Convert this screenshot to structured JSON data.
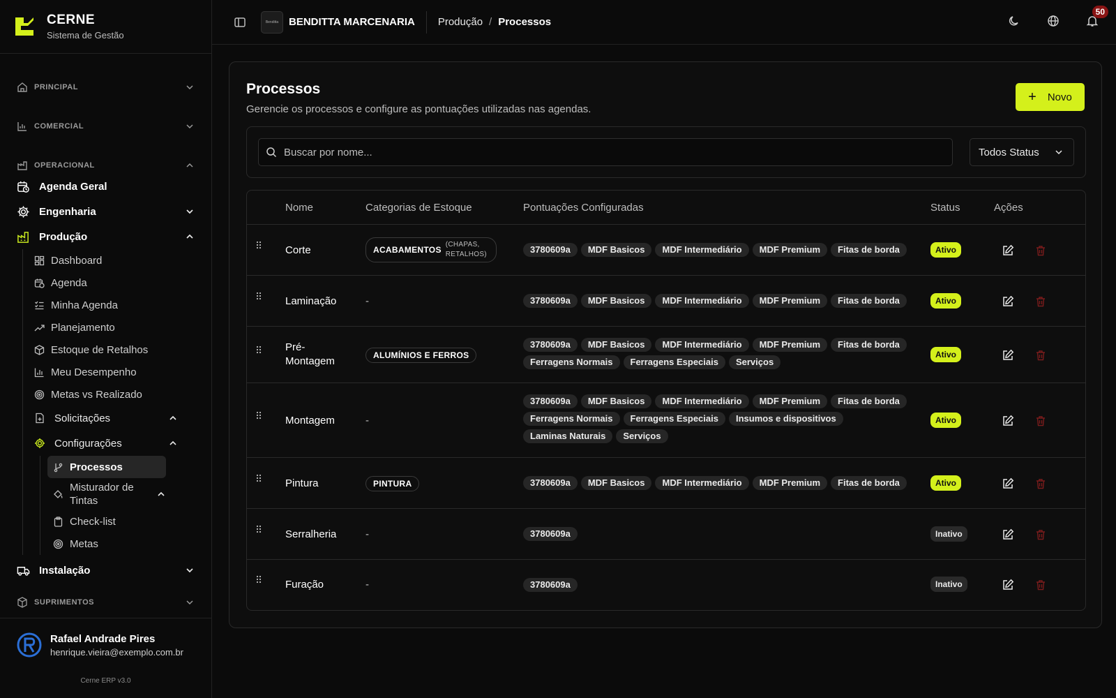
{
  "brand": {
    "title": "CERNE",
    "subtitle": "Sistema de Gestão"
  },
  "sidebar": {
    "sections": {
      "principal": "PRINCIPAL",
      "comercial": "COMERCIAL",
      "operacional": "OPERACIONAL",
      "suprimentos": "SUPRIMENTOS"
    },
    "agenda_geral": "Agenda Geral",
    "engenharia": "Engenharia",
    "producao": "Produção",
    "producao_items": [
      "Dashboard",
      "Agenda",
      "Minha Agenda",
      "Planejamento",
      "Estoque de Retalhos",
      "Meu Desempenho",
      "Metas vs Realizado"
    ],
    "solicitacoes": "Solicitações",
    "configuracoes": "Configurações",
    "config_items": {
      "processos": "Processos",
      "misturador": "Misturador de Tintas",
      "checklist": "Check-list",
      "metas": "Metas"
    },
    "instalacao": "Instalação"
  },
  "user": {
    "name": "Rafael Andrade Pires",
    "email": "henrique.vieira@exemplo.com.br"
  },
  "version": "Cerne ERP v3.0",
  "topbar": {
    "org_logo_text": "Benditta",
    "org_name": "BENDITTA MARCENARIA",
    "crumb1": "Produção",
    "crumb_sep": "/",
    "crumb2": "Processos",
    "notifications": "50"
  },
  "page": {
    "title": "Processos",
    "subtitle": "Gerencie os processos e configure as pontuações utilizadas nas agendas.",
    "new_button": "Novo",
    "search_placeholder": "Buscar por nome...",
    "status_filter": "Todos Status"
  },
  "table": {
    "headers": {
      "nome": "Nome",
      "categorias": "Categorias de Estoque",
      "pontuacoes": "Pontuações Configuradas",
      "status": "Status",
      "acoes": "Ações"
    },
    "rows": [
      {
        "name": "Corte",
        "cat": "ACABAMENTOS",
        "cat_sub": "(CHAPAS, RETALHOS)",
        "tags": [
          "3780609a",
          "MDF Basicos",
          "MDF Intermediário",
          "MDF Premium",
          "Fitas de borda"
        ],
        "status": "Ativo"
      },
      {
        "name": "Laminação",
        "cat": "-",
        "tags": [
          "3780609a",
          "MDF Basicos",
          "MDF Intermediário",
          "MDF Premium",
          "Fitas de borda"
        ],
        "status": "Ativo"
      },
      {
        "name": "Pré-Montagem",
        "cat": "ALUMÍNIOS E FERROS",
        "tags": [
          "3780609a",
          "MDF Basicos",
          "MDF Intermediário",
          "MDF Premium",
          "Fitas de borda",
          "Ferragens Normais",
          "Ferragens Especiais",
          "Serviços"
        ],
        "status": "Ativo"
      },
      {
        "name": "Montagem",
        "cat": "-",
        "tags": [
          "3780609a",
          "MDF Basicos",
          "MDF Intermediário",
          "MDF Premium",
          "Fitas de borda",
          "Ferragens Normais",
          "Ferragens Especiais",
          "Insumos e dispositivos",
          "Laminas Naturais",
          "Serviços"
        ],
        "status": "Ativo"
      },
      {
        "name": "Pintura",
        "cat": "PINTURA",
        "tags": [
          "3780609a",
          "MDF Basicos",
          "MDF Intermediário",
          "MDF Premium",
          "Fitas de borda"
        ],
        "status": "Ativo"
      },
      {
        "name": "Serralheria",
        "cat": "-",
        "tags": [
          "3780609a"
        ],
        "status": "Inativo"
      },
      {
        "name": "Furação",
        "cat": "-",
        "tags": [
          "3780609a"
        ],
        "status": "Inativo"
      }
    ]
  },
  "colors": {
    "accent": "#d4f01b",
    "delete": "#7a1c1c"
  }
}
